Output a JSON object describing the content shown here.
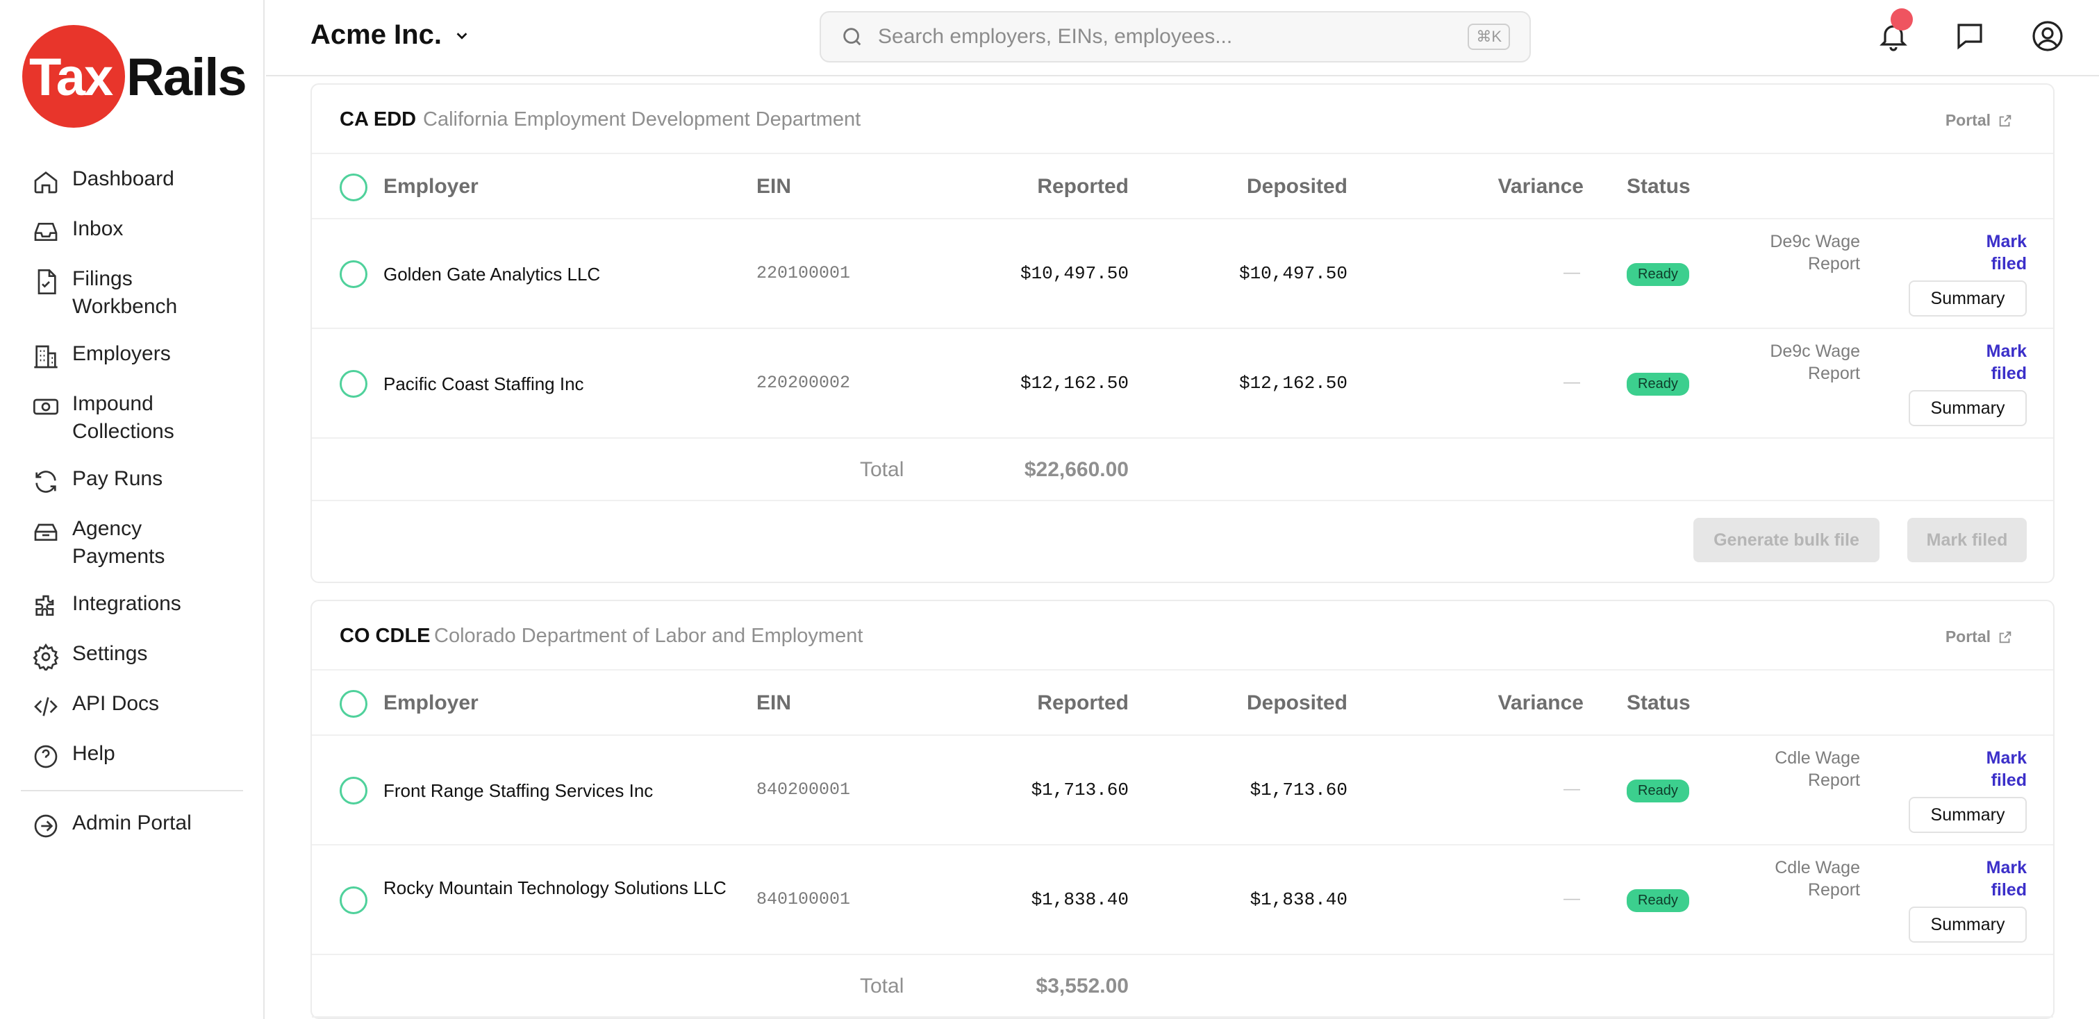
{
  "brand": {
    "logo_left": "Tax",
    "logo_right": "Rails",
    "accent": "#e8352b"
  },
  "sidebar": {
    "items": [
      {
        "label": "Dashboard",
        "icon": "home-icon"
      },
      {
        "label": "Inbox",
        "icon": "inbox-icon"
      },
      {
        "label": "Filings\nWorkbench",
        "icon": "file-check-icon"
      },
      {
        "label": "Employers",
        "icon": "building-icon"
      },
      {
        "label": "Impound\nCollections",
        "icon": "banknote-icon"
      },
      {
        "label": "Pay Runs",
        "icon": "refresh-icon"
      },
      {
        "label": "Agency\nPayments",
        "icon": "vault-icon"
      },
      {
        "label": "Integrations",
        "icon": "puzzle-icon"
      },
      {
        "label": "Settings",
        "icon": "gear-icon"
      },
      {
        "label": "API Docs",
        "icon": "code-icon"
      },
      {
        "label": "Help",
        "icon": "help-icon"
      }
    ],
    "admin": {
      "label": "Admin Portal",
      "icon": "arrow-circle-icon"
    }
  },
  "header": {
    "org_name": "Acme Inc.",
    "search_placeholder": "Search employers, EINs, employees...",
    "search_shortcut": "⌘K"
  },
  "columns": {
    "employer": "Employer",
    "ein": "EIN",
    "reported": "Reported",
    "deposited": "Deposited",
    "variance": "Variance",
    "status": "Status"
  },
  "common": {
    "portal": "Portal",
    "mark_filed": "Mark\nfiled",
    "summary": "Summary",
    "total": "Total",
    "generate_bulk": "Generate bulk file",
    "mark_filed_btn": "Mark filed",
    "dash": "—"
  },
  "agencies": [
    {
      "code": "CA EDD",
      "name": "California Employment Development Department",
      "rows": [
        {
          "employer": "Golden Gate Analytics LLC",
          "ein": "220100001",
          "reported": "$10,497.50",
          "deposited": "$10,497.50",
          "variance": "—",
          "status": "Ready",
          "report": "De9c Wage\nReport"
        },
        {
          "employer": "Pacific Coast Staffing Inc",
          "ein": "220200002",
          "reported": "$12,162.50",
          "deposited": "$12,162.50",
          "variance": "—",
          "status": "Ready",
          "report": "De9c Wage\nReport"
        }
      ],
      "total": "$22,660.00"
    },
    {
      "code": "CO CDLE",
      "name": "Colorado Department of Labor and Employment",
      "rows": [
        {
          "employer": "Front Range Staffing Services Inc",
          "ein": "840200001",
          "reported": "$1,713.60",
          "deposited": "$1,713.60",
          "variance": "—",
          "status": "Ready",
          "report": "Cdle Wage\nReport"
        },
        {
          "employer": "Rocky Mountain Technology Solutions LLC",
          "ein": "840100001",
          "reported": "$1,838.40",
          "deposited": "$1,838.40",
          "variance": "—",
          "status": "Ready",
          "report": "Cdle Wage\nReport"
        }
      ],
      "total": "$3,552.00"
    }
  ]
}
